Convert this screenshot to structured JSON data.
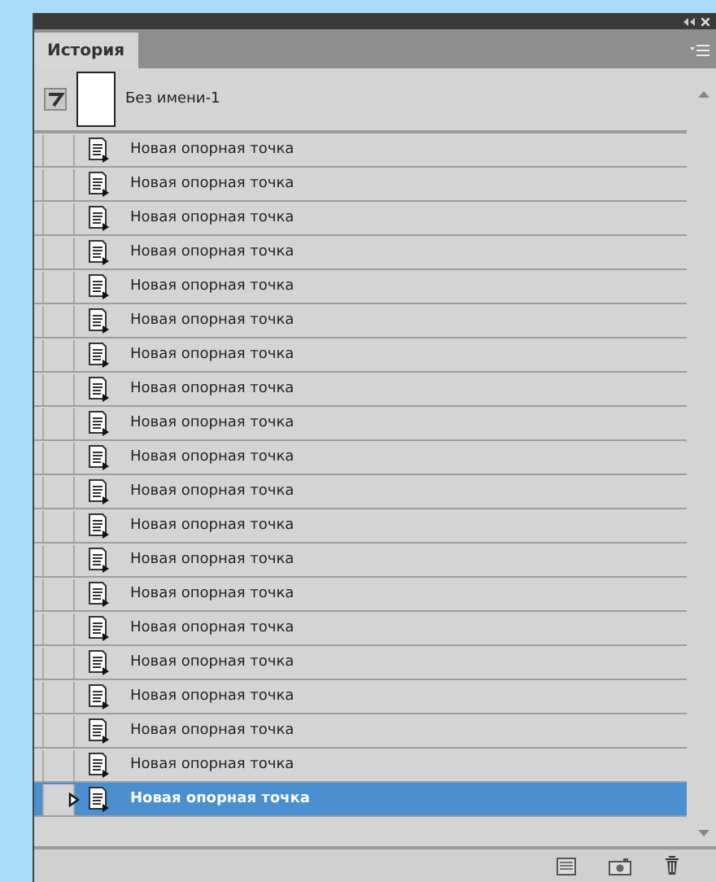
{
  "panel": {
    "tab": {
      "label": "История",
      "selected": true
    },
    "snapshot": {
      "name": "Без имени-1"
    },
    "history": [
      {
        "label": "Новая опорная точка",
        "selected": false
      },
      {
        "label": "Новая опорная точка",
        "selected": false
      },
      {
        "label": "Новая опорная точка",
        "selected": false
      },
      {
        "label": "Новая опорная точка",
        "selected": false
      },
      {
        "label": "Новая опорная точка",
        "selected": false
      },
      {
        "label": "Новая опорная точка",
        "selected": false
      },
      {
        "label": "Новая опорная точка",
        "selected": false
      },
      {
        "label": "Новая опорная точка",
        "selected": false
      },
      {
        "label": "Новая опорная точка",
        "selected": false
      },
      {
        "label": "Новая опорная точка",
        "selected": false
      },
      {
        "label": "Новая опорная точка",
        "selected": false
      },
      {
        "label": "Новая опорная точка",
        "selected": false
      },
      {
        "label": "Новая опорная точка",
        "selected": false
      },
      {
        "label": "Новая опорная точка",
        "selected": false
      },
      {
        "label": "Новая опорная точка",
        "selected": false
      },
      {
        "label": "Новая опорная точка",
        "selected": false
      },
      {
        "label": "Новая опорная точка",
        "selected": false
      },
      {
        "label": "Новая опорная точка",
        "selected": false
      },
      {
        "label": "Новая опорная точка",
        "selected": false
      },
      {
        "label": "Новая опорная точка",
        "selected": true
      }
    ]
  }
}
